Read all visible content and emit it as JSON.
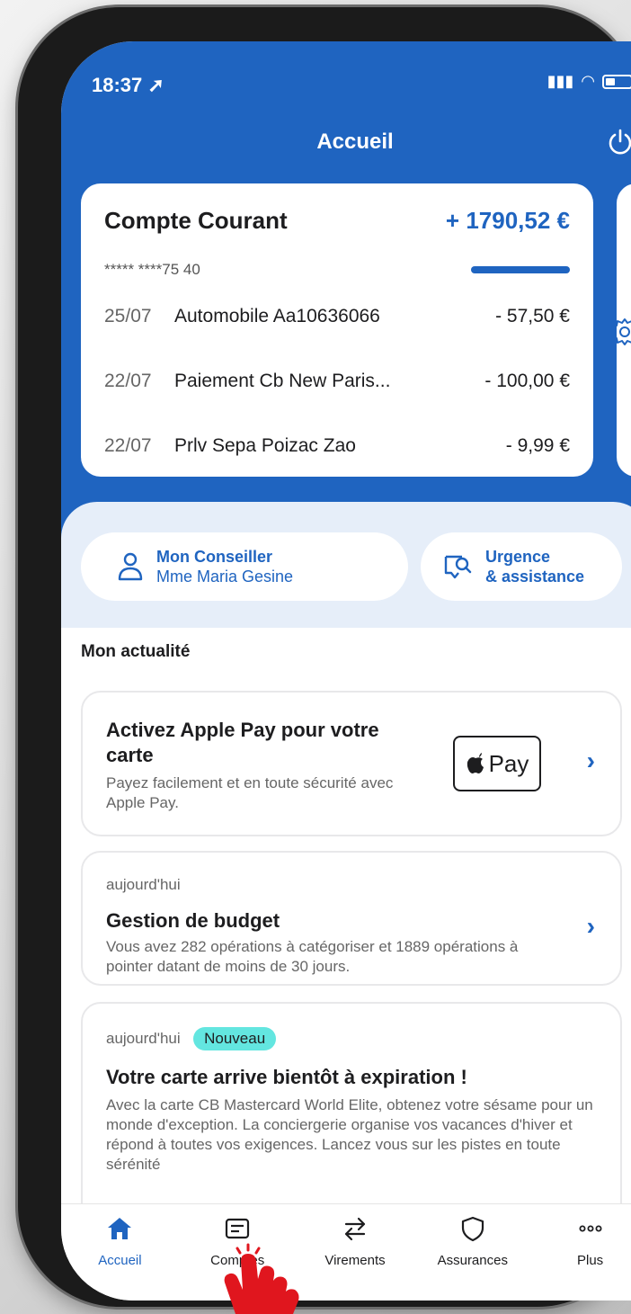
{
  "status_bar": {
    "time": "18:37"
  },
  "header": {
    "title": "Accueil"
  },
  "account": {
    "title": "Compte Courant",
    "balance": "+ 1790,52 €",
    "number": "***** ****75 40",
    "transactions": [
      {
        "date": "25/07",
        "label": "Automobile Aa10636066",
        "amount": "- 57,50 €"
      },
      {
        "date": "22/07",
        "label": "Paiement Cb New Paris...",
        "amount": "- 100,00 €"
      },
      {
        "date": "22/07",
        "label": "Prlv Sepa Poizac Zao",
        "amount": "- 9,99 €"
      }
    ]
  },
  "contacts": {
    "conseiller": {
      "title": "Mon Conseiller",
      "name": "Mme Maria Gesine"
    },
    "urgence": {
      "line1": "Urgence",
      "line2": "& assistance"
    }
  },
  "news": {
    "section_title": "Mon actualité",
    "apple_pay": {
      "title": "Activez Apple Pay pour votre carte",
      "desc": "Payez facilement et en toute sécurité avec Apple Pay.",
      "badge": "Pay"
    },
    "budget": {
      "tag": "aujourd'hui",
      "title": "Gestion de budget",
      "desc": "Vous avez 282 opérations à catégoriser et 1889 opérations à pointer datant de moins de 30 jours."
    },
    "expiration": {
      "tag": "aujourd'hui",
      "badge": "Nouveau",
      "title": "Votre carte arrive bientôt à expiration !",
      "desc": "Avec la carte CB Mastercard World Elite, obtenez votre sésame pour un monde d'exception. La conciergerie organise vos vacances d'hiver et répond à toutes vos exigences. Lancez vous sur les pistes en toute sérénité"
    }
  },
  "tabbar": {
    "items": [
      {
        "label": "Accueil",
        "icon": "home-icon"
      },
      {
        "label": "Comptes",
        "icon": "card-icon"
      },
      {
        "label": "Virements",
        "icon": "transfer-icon"
      },
      {
        "label": "Assurances",
        "icon": "shield-icon"
      },
      {
        "label": "Plus",
        "icon": "more-icon"
      }
    ],
    "active": "Accueil"
  },
  "colors": {
    "primary": "#1f64c0",
    "panel": "#e6eef9",
    "badge": "#63e6e0"
  }
}
